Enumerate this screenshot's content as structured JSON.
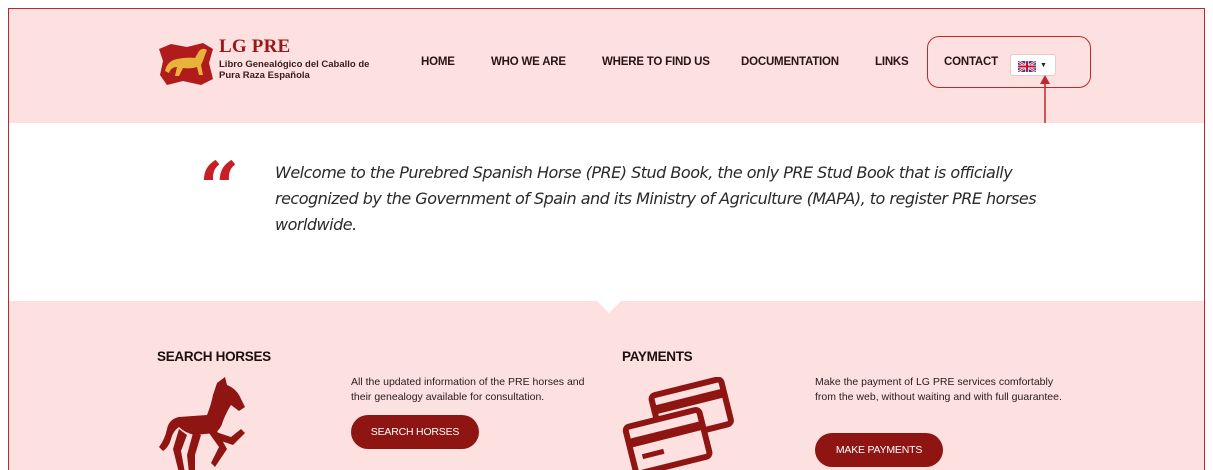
{
  "header": {
    "logo_title": "LG PRE",
    "logo_subtitle": "Libro Genealógico del Caballo de Pura Raza Española",
    "nav": [
      "HOME",
      "WHO WE ARE",
      "WHERE TO FIND US",
      "DOCUMENTATION",
      "LINKS",
      "CONTACT"
    ],
    "language": "English (UK flag)"
  },
  "welcome": {
    "quote_mark": "“",
    "text": "Welcome to the Purebred Spanish Horse (PRE) Stud Book, the only PRE Stud Book that is officially recognized by the Government of Spain and its Ministry of Agriculture (MAPA), to register PRE horses worldwide."
  },
  "services": {
    "search": {
      "title": "SEARCH HORSES",
      "description": "All the updated information of the PRE horses and their genealogy available for consultation.",
      "button": "SEARCH HORSES",
      "icon": "horse-icon"
    },
    "payments": {
      "title": "PAYMENTS",
      "description": "Make the payment of LG PRE services comfortably from the web, without waiting and with full guarantee.",
      "button": "MAKE PAYMENTS",
      "icon": "credit-cards-icon"
    }
  },
  "colors": {
    "background": "#fde0e0",
    "brand": "#9b1818",
    "button": "#8e1511",
    "quote": "#c62026",
    "annotation": "#c0282a"
  }
}
